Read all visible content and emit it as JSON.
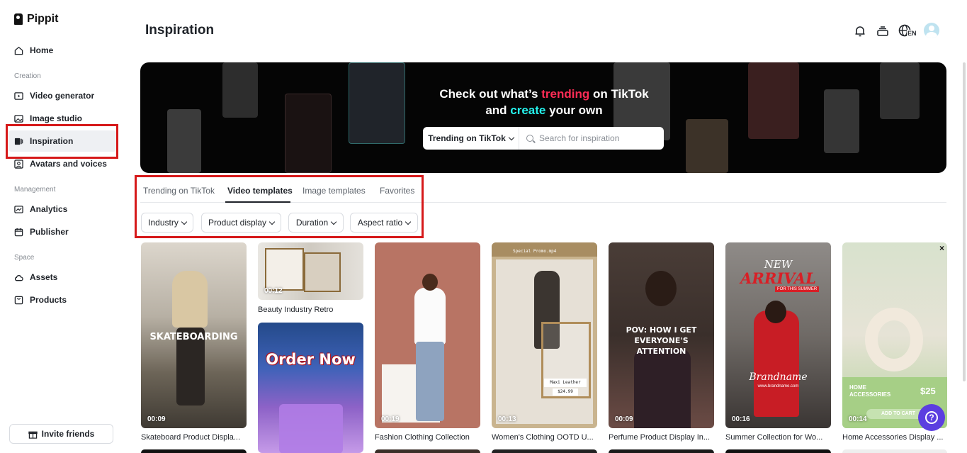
{
  "app": {
    "name": "Pippit"
  },
  "sidebar": {
    "home": "Home",
    "sections": {
      "creation": "Creation",
      "management": "Management",
      "space": "Space"
    },
    "items": [
      {
        "label": "Video generator",
        "icon": "video-generator-icon"
      },
      {
        "label": "Image studio",
        "icon": "image-studio-icon"
      },
      {
        "label": "Inspiration",
        "icon": "inspiration-icon",
        "active": true
      },
      {
        "label": "Avatars and voices",
        "icon": "avatar-icon"
      },
      {
        "label": "Analytics",
        "icon": "analytics-icon"
      },
      {
        "label": "Publisher",
        "icon": "calendar-icon"
      },
      {
        "label": "Assets",
        "icon": "cloud-icon"
      },
      {
        "label": "Products",
        "icon": "products-icon"
      }
    ],
    "invite": "Invite friends"
  },
  "header": {
    "title": "Inspiration",
    "language": "EN",
    "icons": [
      "bell-icon",
      "layers-icon",
      "globe-icon",
      "avatar"
    ]
  },
  "banner": {
    "line1_a": "Check out what’s ",
    "line1_b": "trending",
    "line1_c": " on TikTok",
    "line2_a": "and ",
    "line2_b": "create",
    "line2_c": " your own",
    "search_type": "Trending on TikTok",
    "search_placeholder": "Search for inspiration",
    "colors": {
      "pink": "#fe2c55",
      "cyan": "#25f4ee"
    }
  },
  "tabs": [
    {
      "label": "Trending on TikTok"
    },
    {
      "label": "Video templates",
      "active": true
    },
    {
      "label": "Image templates"
    },
    {
      "label": "Favorites"
    }
  ],
  "filters": [
    "Industry",
    "Product display",
    "Duration",
    "Aspect ratio"
  ],
  "cards": [
    {
      "title": "Skateboard Product Displa...",
      "duration": "00:09",
      "overlay": "SKATEBOARDING"
    },
    {
      "title": "Beauty Industry Retro",
      "duration": "00:12",
      "overlay": ""
    },
    {
      "title": "",
      "duration": "",
      "overlay": "Order Now"
    },
    {
      "title": "Fashion Clothing Collection",
      "duration": "00:19",
      "overlay": ""
    },
    {
      "title": "Women's Clothing OOTD U...",
      "duration": "00:13",
      "overlay": "Maxi Leather Skirt",
      "price": "$24.99",
      "file": "Special Promo.mp4"
    },
    {
      "title": "Perfume Product Display In...",
      "duration": "00:09",
      "overlay": "POV: HOW I GET EVERYONE'S ATTENTION"
    },
    {
      "title": "Summer Collection for Wo...",
      "duration": "00:16",
      "overlay_a": "NEW",
      "overlay_b": "ARRIVAL",
      "overlay_c": "FOR THIS SUMMER",
      "brand": "Brandname",
      "brand_url": "www.brandname.com"
    },
    {
      "title": "Home Accessories Display ...",
      "duration": "00:14",
      "overlay": "HOME ACCESSORIES",
      "price": "$25",
      "cta": "ADD TO CART"
    }
  ],
  "help": "?",
  "close": "×"
}
